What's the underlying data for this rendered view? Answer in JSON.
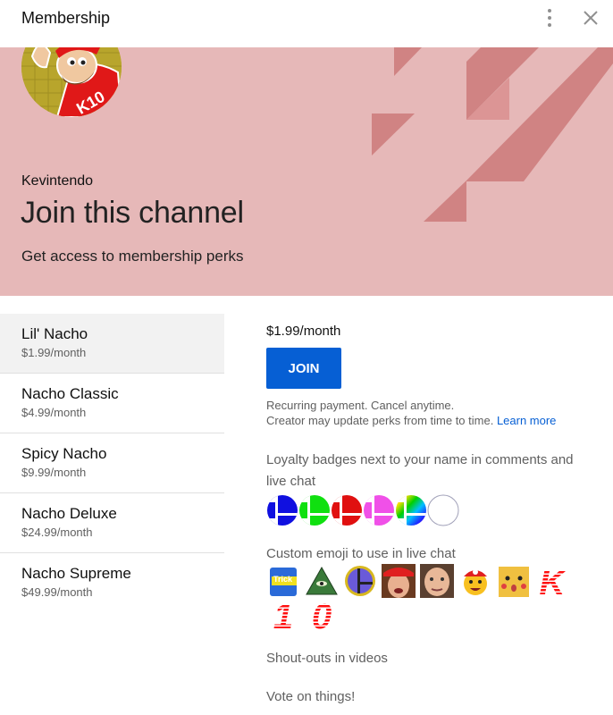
{
  "header": {
    "title": "Membership",
    "menu_icon": "more-vert-icon",
    "close_icon": "close-icon"
  },
  "banner": {
    "background_color": "#e6b8b8",
    "accent_shape_color": "#d08383",
    "channel_name": "Kevintendo",
    "title": "Join this channel",
    "subtitle": "Get access to membership perks",
    "avatar_text": "K10"
  },
  "tiers": [
    {
      "name": "Lil' Nacho",
      "price": "$1.99/month",
      "selected": true
    },
    {
      "name": "Nacho Classic",
      "price": "$4.99/month",
      "selected": false
    },
    {
      "name": "Spicy Nacho",
      "price": "$9.99/month",
      "selected": false
    },
    {
      "name": "Nacho Deluxe",
      "price": "$24.99/month",
      "selected": false
    },
    {
      "name": "Nacho Supreme",
      "price": "$49.99/month",
      "selected": false
    }
  ],
  "details": {
    "price": "$1.99/month",
    "join_label": "JOIN",
    "join_color": "#065fd4",
    "note_line1": "Recurring payment. Cancel anytime.",
    "note_line2": "Creator may update perks from time to time.",
    "learn_more": "Learn more",
    "perks": {
      "badges_text": "Loyalty badges next to your name in comments and live chat",
      "emoji_text": "Custom emoji to use in live chat",
      "shoutouts": "Shout-outs in videos",
      "vote": "Vote on things!"
    },
    "badges": [
      {
        "name": "smash-badge-blue",
        "color": "#1010e0"
      },
      {
        "name": "smash-badge-green",
        "color": "#10e010"
      },
      {
        "name": "smash-badge-red",
        "color": "#e01010"
      },
      {
        "name": "smash-badge-pink",
        "color": "#f050e8"
      },
      {
        "name": "smash-badge-rainbow",
        "color": "rainbow"
      },
      {
        "name": "smash-badge-white",
        "color": "#ffffff"
      }
    ],
    "emojis": [
      {
        "name": "drink-can-emoji"
      },
      {
        "name": "illuminati-pyramid-emoji"
      },
      {
        "name": "smash-ball-emoji"
      },
      {
        "name": "face-red-cap-emoji"
      },
      {
        "name": "face-emoji"
      },
      {
        "name": "mario-cat-emoji"
      },
      {
        "name": "pikachu-emoji",
        "text": ""
      },
      {
        "name": "letter-k-emoji",
        "text": "K"
      },
      {
        "name": "digit-1-emoji",
        "text": "1"
      },
      {
        "name": "digit-0-emoji",
        "text": "0"
      }
    ]
  }
}
